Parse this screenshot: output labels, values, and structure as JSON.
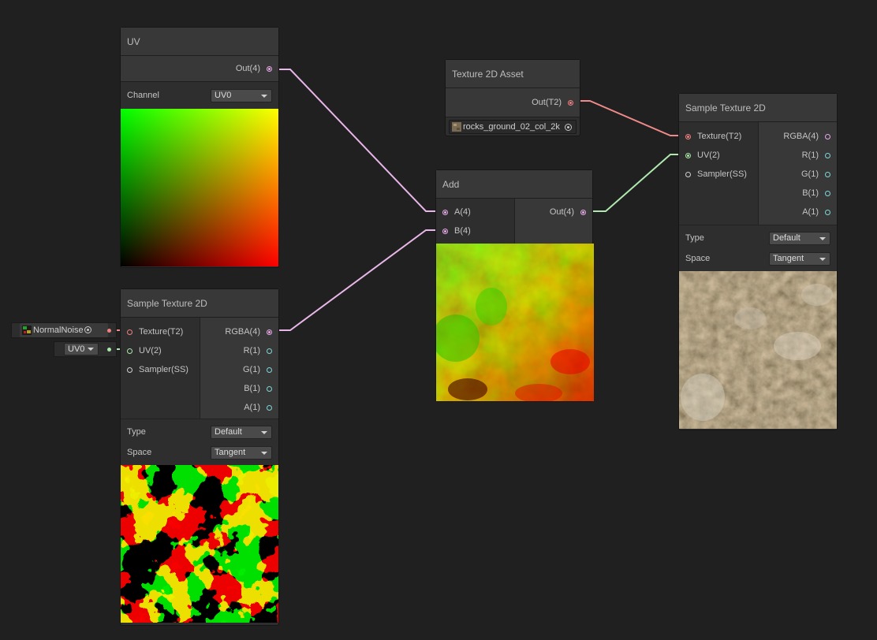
{
  "colors": {
    "background": "#202020",
    "node_bg": "#2e2e2e",
    "title_bg": "#383838",
    "vector4_port": "#e8a8e8",
    "texture_port": "#f08080",
    "vector2_port": "#a8e8a8",
    "vector1_port": "#7fd6d6"
  },
  "uv_node": {
    "title": "UV",
    "output": "Out(4)",
    "channel_label": "Channel",
    "channel_value": "UV0"
  },
  "texture_asset_node": {
    "title": "Texture 2D Asset",
    "output": "Out(T2)",
    "texture_name": "rocks_ground_02_col_2k"
  },
  "add_node": {
    "title": "Add",
    "inputs": [
      "A(4)",
      "B(4)"
    ],
    "output": "Out(4)"
  },
  "sample_left": {
    "title": "Sample Texture 2D",
    "inputs": [
      "Texture(T2)",
      "UV(2)",
      "Sampler(SS)"
    ],
    "outputs": [
      "RGBA(4)",
      "R(1)",
      "G(1)",
      "B(1)",
      "A(1)"
    ],
    "type_label": "Type",
    "type_value": "Default",
    "space_label": "Space",
    "space_value": "Tangent",
    "texture_field": "NormalNoise",
    "uv_field": "UV0"
  },
  "sample_right": {
    "title": "Sample Texture 2D",
    "inputs": [
      "Texture(T2)",
      "UV(2)",
      "Sampler(SS)"
    ],
    "outputs": [
      "RGBA(4)",
      "R(1)",
      "G(1)",
      "B(1)",
      "A(1)"
    ],
    "type_label": "Type",
    "type_value": "Default",
    "space_label": "Space",
    "space_value": "Tangent"
  }
}
